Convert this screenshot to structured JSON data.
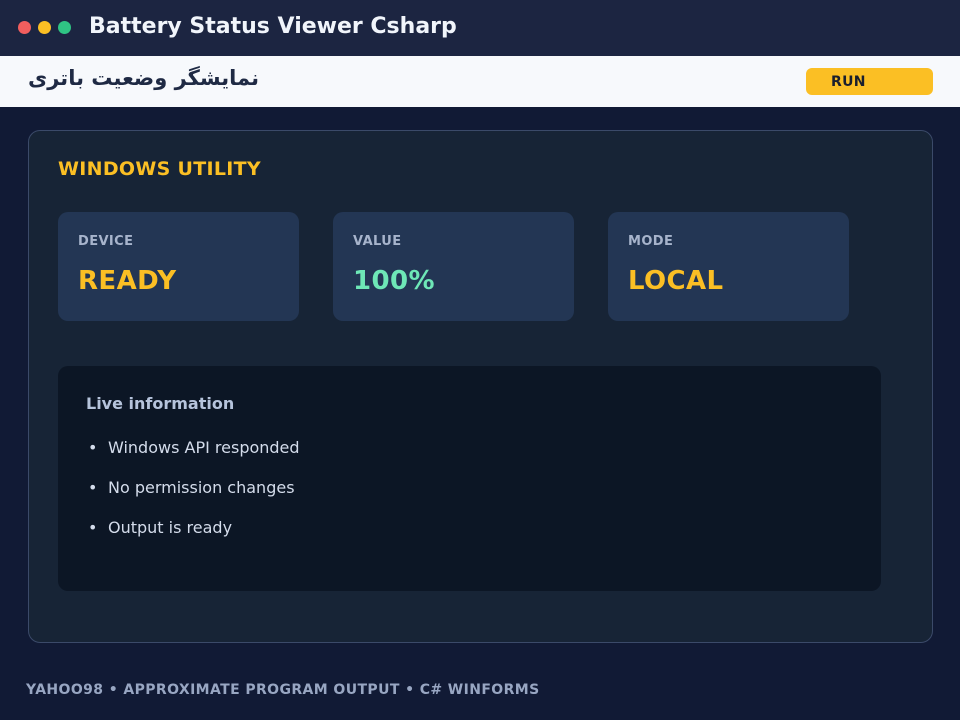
{
  "window": {
    "title": "Battery Status Viewer Csharp",
    "controls": [
      "close",
      "minimize",
      "maximize"
    ]
  },
  "subheader": {
    "title": "نمایشگر وضعیت باتری",
    "run_label": "RUN"
  },
  "panel": {
    "title": "WINDOWS UTILITY",
    "cards": [
      {
        "label": "DEVICE",
        "value": "READY",
        "color": "#fbbf24"
      },
      {
        "label": "VALUE",
        "value": "100%",
        "color": "#6ee7b7"
      },
      {
        "label": "MODE",
        "value": "LOCAL",
        "color": "#fbbf24"
      }
    ],
    "info": {
      "title": "Live information",
      "bullet": "•",
      "items": [
        "Windows API responded",
        "No permission changes",
        "Output is ready"
      ]
    }
  },
  "footer": {
    "text": "YAHOO98  •  APPROXIMATE PROGRAM OUTPUT  •  C# WINFORMS"
  },
  "colors": {
    "accent": "#fbbf24",
    "success": "#6ee7b7",
    "background": "#111a35"
  }
}
